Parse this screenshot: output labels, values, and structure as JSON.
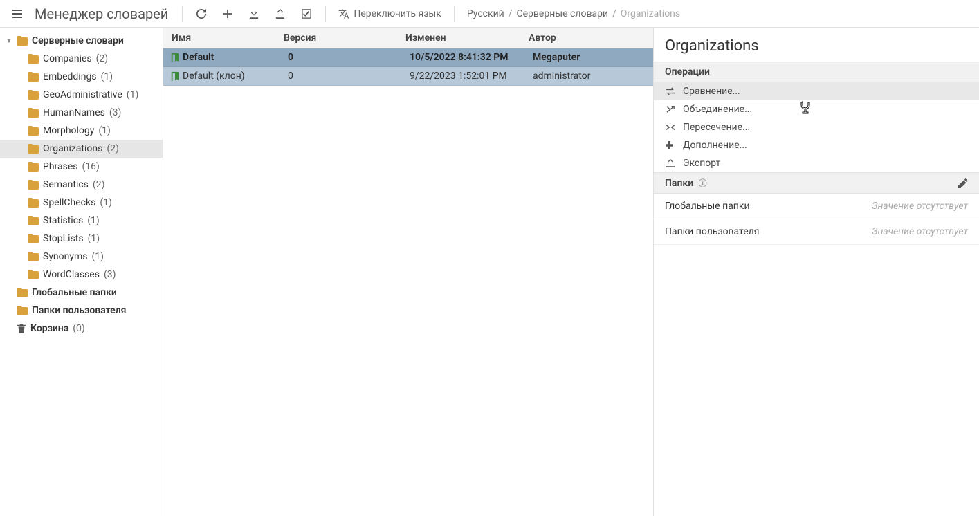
{
  "toolbar": {
    "title": "Менеджер словарей",
    "switch_lang": "Переключить язык"
  },
  "breadcrumb": {
    "a": "Русский",
    "b": "Серверные словари",
    "c": "Organizations"
  },
  "tree": {
    "root": "Серверные словари",
    "items": [
      {
        "label": "Companies",
        "count": "(2)"
      },
      {
        "label": "Embeddings",
        "count": "(1)"
      },
      {
        "label": "GeoAdministrative",
        "count": "(1)"
      },
      {
        "label": "HumanNames",
        "count": "(3)"
      },
      {
        "label": "Morphology",
        "count": "(1)"
      },
      {
        "label": "Organizations",
        "count": "(2)"
      },
      {
        "label": "Phrases",
        "count": "(16)"
      },
      {
        "label": "Semantics",
        "count": "(2)"
      },
      {
        "label": "SpellChecks",
        "count": "(1)"
      },
      {
        "label": "Statistics",
        "count": "(1)"
      },
      {
        "label": "StopLists",
        "count": "(1)"
      },
      {
        "label": "Synonyms",
        "count": "(1)"
      },
      {
        "label": "WordClasses",
        "count": "(3)"
      }
    ],
    "global": "Глобальные папки",
    "user": "Папки пользователя",
    "trash_label": "Корзина",
    "trash_count": "(0)"
  },
  "table": {
    "headers": {
      "name": "Имя",
      "version": "Версия",
      "modified": "Изменен",
      "author": "Автор"
    },
    "rows": [
      {
        "name": "Default",
        "version": "0",
        "modified": "10/5/2022 8:41:32 PM",
        "author": "Megaputer"
      },
      {
        "name": "Default (клон)",
        "version": "0",
        "modified": "9/22/2023 1:52:01 PM",
        "author": "administrator"
      }
    ]
  },
  "right": {
    "title": "Organizations",
    "ops_header": "Операции",
    "ops": [
      "Сравнение...",
      "Объединение...",
      "Пересечение...",
      "Дополнение...",
      "Экспорт"
    ],
    "folders_header": "Папки",
    "folder_rows": [
      {
        "label": "Глобальные папки",
        "value": "Значение отсутствует"
      },
      {
        "label": "Папки пользователя",
        "value": "Значение отсутствует"
      }
    ]
  }
}
